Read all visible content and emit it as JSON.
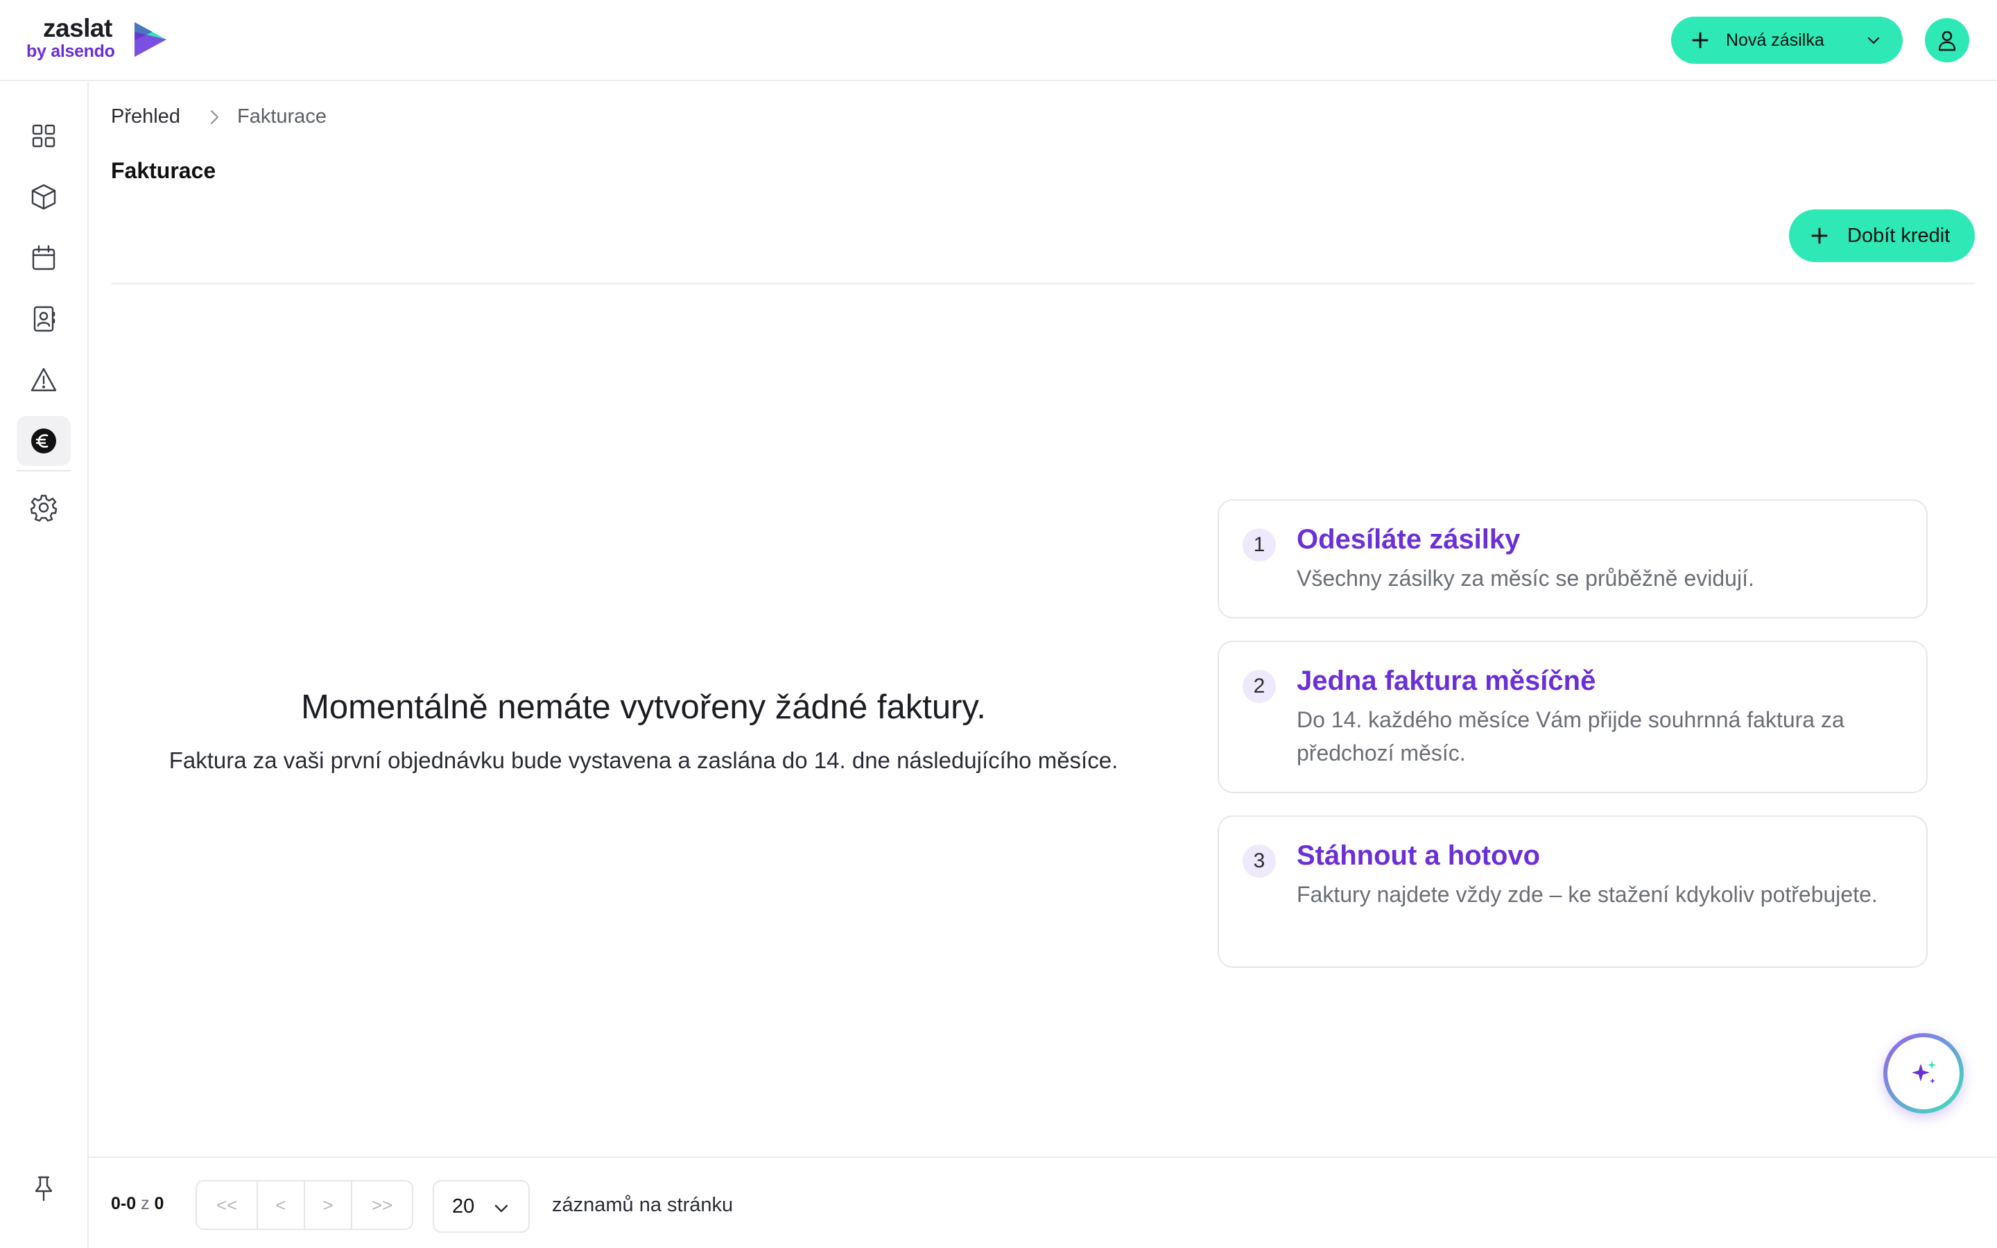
{
  "brand": {
    "name": "zaslat",
    "sub": "by alsendo"
  },
  "header": {
    "new_shipment_label": "Nová zásilka"
  },
  "sidebar": {
    "items": [
      {
        "icon": "dashboard-grid-icon"
      },
      {
        "icon": "package-icon"
      },
      {
        "icon": "calendar-icon"
      },
      {
        "icon": "address-book-icon"
      },
      {
        "icon": "warning-icon"
      },
      {
        "icon": "euro-billing-icon",
        "active": true
      },
      {
        "icon": "settings-gear-icon"
      },
      {
        "icon": "pin-icon"
      }
    ]
  },
  "breadcrumb": {
    "home": "Přehled",
    "current": "Fakturace"
  },
  "page": {
    "title": "Fakturace",
    "topup_label": "Dobít kredit"
  },
  "empty_state": {
    "title": "Momentálně nemáte vytvořeny žádné faktury.",
    "subtitle": "Faktura za vaši první objednávku bude vystavena a zaslána do 14. dne následujícího měsíce."
  },
  "steps": [
    {
      "num": "1",
      "title": "Odesíláte zásilky",
      "desc": "Všechny zásilky za měsíc se průběžně evidují."
    },
    {
      "num": "2",
      "title": "Jedna faktura měsíčně",
      "desc": "Do 14. každého měsíce Vám přijde souhrnná faktura za předchozí měsíc."
    },
    {
      "num": "3",
      "title": "Stáhnout a hotovo",
      "desc": "Faktury najdete vždy zde – ke stažení kdykoliv potřebujete."
    }
  ],
  "pagination": {
    "range": "0-0",
    "of": "z",
    "total": "0",
    "first": "<<",
    "prev": "<",
    "next": ">",
    "last": ">>",
    "page_size": "20",
    "per_page_label": "záznamů na stránku"
  },
  "colors": {
    "accent": "#2ee8b6",
    "brand_purple": "#6b2fd6"
  }
}
